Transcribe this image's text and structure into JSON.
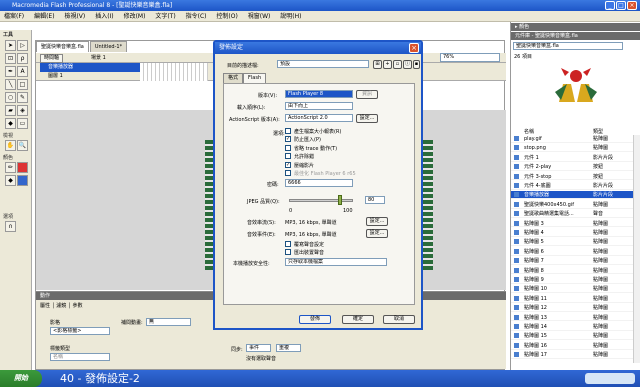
{
  "window": {
    "title": "Macromedia Flash Professional 8 - [聖誕快樂音樂盒.fla]"
  },
  "menu": [
    "檔案(F)",
    "編輯(E)",
    "檢視(V)",
    "插入(I)",
    "修改(M)",
    "文字(T)",
    "指令(C)",
    "控制(O)",
    "視窗(W)",
    "說明(H)"
  ],
  "tools": {
    "header": "工具",
    "view_label": "檢視",
    "color_label": "顏色",
    "options_label": "選項"
  },
  "document": {
    "tabs": [
      "聖誕快樂音樂盒.fla",
      "Untitled-1*"
    ],
    "timeline_button": "時間軸",
    "scene_label": "場景 1",
    "layers": [
      "音樂播放器",
      "圖層 1"
    ],
    "zoom": "76%"
  },
  "actions_panel": {
    "header": "動作",
    "tabs": [
      "屬性",
      "濾鏡",
      "參數"
    ],
    "shape_label": "影格",
    "frame_label_placeholder": "<影格標籤>",
    "tween_label": "補間動畫:",
    "tween_value": "無",
    "label_type": "標籤類型",
    "label_type_value": "名稱",
    "sync_label": "同步:",
    "sync_value": "事件",
    "repeat_value": "重複",
    "no_sound": "沒有選取聲音"
  },
  "library": {
    "header_color": "元件庫 - 聖誕快樂音樂盒.fla",
    "file": "聖誕快樂音樂盒.fla",
    "count": "26 項目",
    "col_name": "名稱",
    "col_type": "類型",
    "items": [
      {
        "name": "play.gif",
        "type": "點陣圖"
      },
      {
        "name": "stop.png",
        "type": "點陣圖"
      },
      {
        "name": "元件 1",
        "type": "影片片段"
      },
      {
        "name": "元件 2-play",
        "type": "按鈕"
      },
      {
        "name": "元件 3-stop",
        "type": "按鈕"
      },
      {
        "name": "元件 4-底圖",
        "type": "影片片段"
      },
      {
        "name": "音樂播放器",
        "type": "影片片段"
      },
      {
        "name": "聖誕快樂400x450.gif",
        "type": "點陣圖"
      },
      {
        "name": "聖誕歌曲精選集電話...",
        "type": "聲音"
      },
      {
        "name": "點陣圖 3",
        "type": "點陣圖"
      },
      {
        "name": "點陣圖 4",
        "type": "點陣圖"
      },
      {
        "name": "點陣圖 5",
        "type": "點陣圖"
      },
      {
        "name": "點陣圖 6",
        "type": "點陣圖"
      },
      {
        "name": "點陣圖 7",
        "type": "點陣圖"
      },
      {
        "name": "點陣圖 8",
        "type": "點陣圖"
      },
      {
        "name": "點陣圖 9",
        "type": "點陣圖"
      },
      {
        "name": "點陣圖 10",
        "type": "點陣圖"
      },
      {
        "name": "點陣圖 11",
        "type": "點陣圖"
      },
      {
        "name": "點陣圖 12",
        "type": "點陣圖"
      },
      {
        "name": "點陣圖 13",
        "type": "點陣圖"
      },
      {
        "name": "點陣圖 14",
        "type": "點陣圖"
      },
      {
        "name": "點陣圖 15",
        "type": "點陣圖"
      },
      {
        "name": "點陣圖 16",
        "type": "點陣圖"
      },
      {
        "name": "點陣圖 17",
        "type": "點陣圖"
      }
    ],
    "selected_index": 6
  },
  "dialog": {
    "title": "發佈設定",
    "profile_label": "目前的描述檔:",
    "profile_value": "預設",
    "tabs": [
      "格式",
      "Flash"
    ],
    "version_label": "版本(V):",
    "version_value": "Flash Player 8",
    "version_info": "資訊",
    "load_order_label": "載入順序(L):",
    "load_order_value": "由下而上",
    "as_label": "ActionScript 版本(A):",
    "as_value": "ActionScript 2.0",
    "settings_btn": "設定...",
    "options_label": "選項:",
    "options": [
      {
        "label": "產生檔案大小報表(R)",
        "checked": false
      },
      {
        "label": "防止匯入(P)",
        "checked": true
      },
      {
        "label": "省略 trace 動作(T)",
        "checked": false
      },
      {
        "label": "允許除錯",
        "checked": false
      },
      {
        "label": "壓縮影片",
        "checked": true
      },
      {
        "label": "最佳化 Flash Player 6 r65",
        "checked": false
      }
    ],
    "password_label": "密碼:",
    "password_value": "6666",
    "jpeg_label": "JPEG 品質(Q):",
    "jpeg_value": "80",
    "jpeg_min": "0",
    "jpeg_max": "100",
    "jpeg_fraction": 0.8,
    "audio_stream_label": "音效串流(S):",
    "audio_stream_value": "MP3, 16 kbps, 單聲道",
    "audio_event_label": "音效事件(E):",
    "audio_event_value": "MP3, 16 kbps, 單聲道",
    "override_label": "覆寫聲音設定",
    "export_label": "匯出裝置聲音",
    "security_label": "本機播放安全性:",
    "security_value": "只存取本機檔案",
    "publish_btn": "發佈",
    "ok_btn": "確定",
    "cancel_btn": "取消"
  },
  "taskbar": {
    "start": "開始",
    "caption": "40 - 發佈設定-2"
  },
  "accent": "#1d55c7"
}
